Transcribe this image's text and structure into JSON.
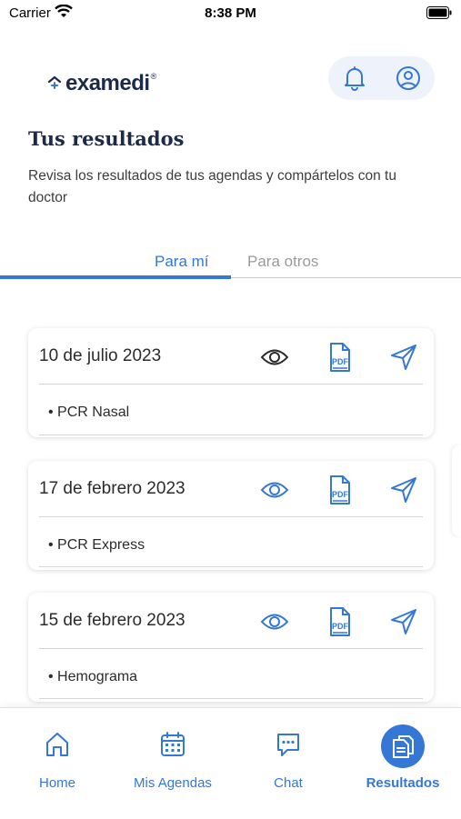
{
  "status_bar": {
    "carrier": "Carrier",
    "time": "8:38 PM"
  },
  "brand": {
    "name": "examedi",
    "reg": "®"
  },
  "header": {
    "icons": [
      "bell-icon",
      "user-circle-icon"
    ]
  },
  "page": {
    "title": "Tus resultados",
    "subtitle": "Revisa los resultados de tus agendas y compártelos con tu doctor"
  },
  "tabs": {
    "active": "Para mí",
    "other": "Para otros"
  },
  "results": [
    {
      "date": "10 de julio 2023",
      "exam": "• PCR Nasal"
    },
    {
      "date": "17 de febrero 2023",
      "exam": "• PCR Express"
    },
    {
      "date": "15 de febrero 2023",
      "exam": "• Hemograma"
    }
  ],
  "nav": {
    "home": "Home",
    "agendas": "Mis Agendas",
    "chat": "Chat",
    "results": "Resultados"
  },
  "colors": {
    "accent": "#3577d4",
    "brand_dark": "#1c2a4a",
    "header_pill": "#eef2fb"
  }
}
